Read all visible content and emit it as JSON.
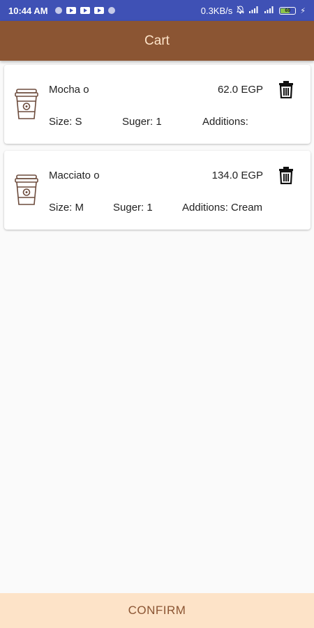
{
  "status_bar": {
    "time": "10:44 AM",
    "network_speed": "0.3KB/s",
    "battery_level": "69",
    "icons": [
      "notification-dot-icon",
      "youtube-icon",
      "youtube-icon",
      "youtube-icon",
      "notification-dot-icon",
      "alarm-icon",
      "signal-icon",
      "signal-icon",
      "battery-icon",
      "charging-icon"
    ]
  },
  "app_bar": {
    "title": "Cart"
  },
  "cart": {
    "items": [
      {
        "name": "Mocha o",
        "price": "62.0  EGP",
        "size": "Size: S",
        "suger": "Suger: 1",
        "additions": "Additions:",
        "icon": "coffee-cup-icon"
      },
      {
        "name": "Macciato o",
        "price": "134.0  EGP",
        "size": "Size: M",
        "suger": "Suger: 1",
        "additions": "Additions: Cream",
        "icon": "coffee-cup-icon"
      }
    ]
  },
  "confirm": {
    "label": "CONFIRM"
  },
  "colors": {
    "status_bar": "#3f51b5",
    "app_bar": "#8b5533",
    "app_bar_text": "#fde3c8",
    "confirm_bg": "#fde3c8",
    "confirm_text": "#8b5533",
    "background": "#fafafa"
  }
}
